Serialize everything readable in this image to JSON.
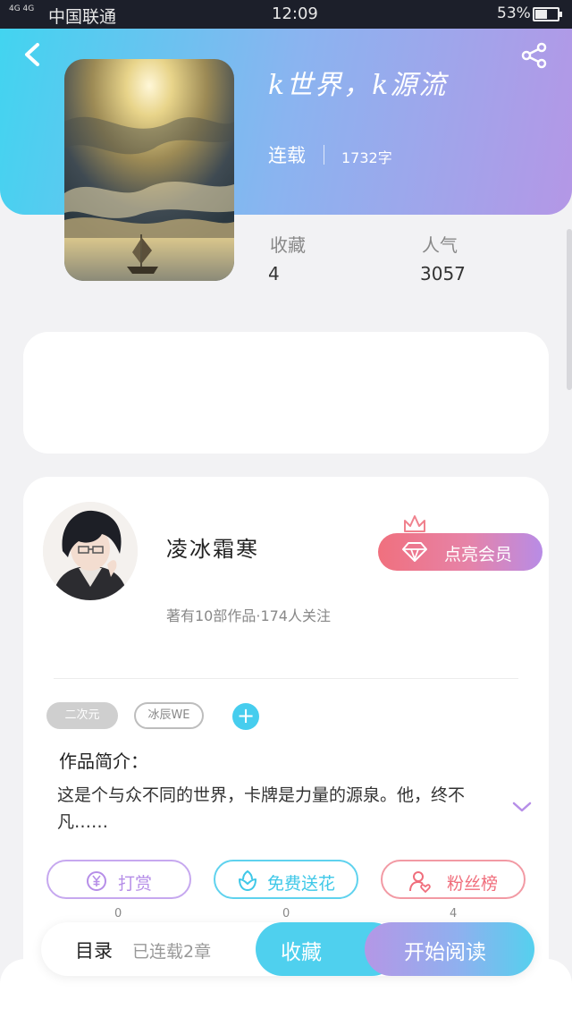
{
  "status_bar": {
    "signal": "4G 4G",
    "carrier": "中国联通",
    "time": "12:09",
    "battery": "53%"
  },
  "book": {
    "title": "k世界，k源流",
    "status": "连载",
    "word_count": "1732字",
    "stats": [
      {
        "label": "收藏",
        "value": "4"
      },
      {
        "label": "人气",
        "value": "3057"
      }
    ]
  },
  "author": {
    "name": "凌冰霜寒",
    "meta": "著有10部作品·174人关注",
    "vip_button": "点亮会员"
  },
  "tags": [
    "二次元",
    "冰辰WE"
  ],
  "intro": {
    "title": "作品简介：",
    "text": "这是个与众不同的世界，卡牌是力量的源泉。他，终不凡……"
  },
  "actions": [
    {
      "label": "打赏",
      "count": "0",
      "color": "#b68ee8"
    },
    {
      "label": "免费送花",
      "count": "0",
      "color": "#3fc8e8"
    },
    {
      "label": "粉丝榜",
      "count": "4",
      "color": "#f06e7c"
    }
  ],
  "bottom_bar": {
    "toc_label": "目录",
    "toc_info": "已连载2章",
    "collect": "收藏",
    "read": "开始阅读"
  },
  "icons": [
    "back-icon",
    "share-icon",
    "crown-icon",
    "diamond-icon",
    "plus-icon",
    "chevron-down-icon",
    "yen-icon",
    "flower-icon",
    "user-heart-icon"
  ]
}
